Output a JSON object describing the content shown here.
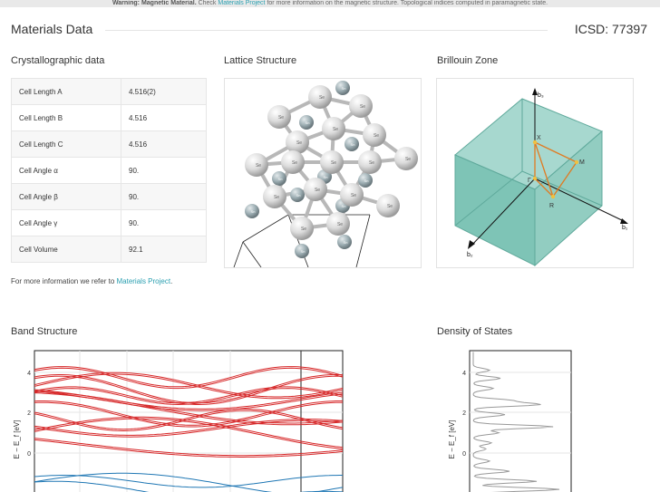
{
  "warning": {
    "prefix": "Warning: Magnetic Material.",
    "text1": " Check ",
    "link": "Materials Project",
    "text2": " for more information on the magnetic structure. Topological indices computed in paramagnetic state."
  },
  "header": {
    "title": "Materials Data",
    "icsd": "ICSD: 77397"
  },
  "crystallographic": {
    "title": "Crystallographic data",
    "rows": [
      {
        "label": "Cell Length A",
        "value": "4.516(2)"
      },
      {
        "label": "Cell Length B",
        "value": "4.516"
      },
      {
        "label": "Cell Length C",
        "value": "4.516"
      },
      {
        "label": "Cell Angle α",
        "value": "90."
      },
      {
        "label": "Cell Angle β",
        "value": "90."
      },
      {
        "label": "Cell Angle γ",
        "value": "90."
      },
      {
        "label": "Cell Volume",
        "value": "92.1"
      }
    ]
  },
  "more_info": {
    "prefix": "For more information we refer to ",
    "link": "Materials Project",
    "suffix": "."
  },
  "lattice": {
    "title": "Lattice Structure",
    "atom_labels": [
      "Se",
      "Sn"
    ]
  },
  "brillouin": {
    "title": "Brillouin Zone",
    "points": [
      "X",
      "M",
      "R",
      "Γ"
    ],
    "axes": [
      "b₁",
      "b₂",
      "b₃"
    ]
  },
  "band": {
    "title": "Band Structure",
    "ylabel": "E − E_f [eV]",
    "yticks": [
      "4",
      "2",
      "0"
    ]
  },
  "dos": {
    "title": "Density of States",
    "ylabel": "E − E_f [eV]",
    "yticks": [
      "4",
      "2",
      "0"
    ]
  },
  "colors": {
    "accent": "#2a9fb0",
    "conduction": "#d62728",
    "valence": "#1f77b4",
    "bz_fill": "#7ec4b6"
  }
}
